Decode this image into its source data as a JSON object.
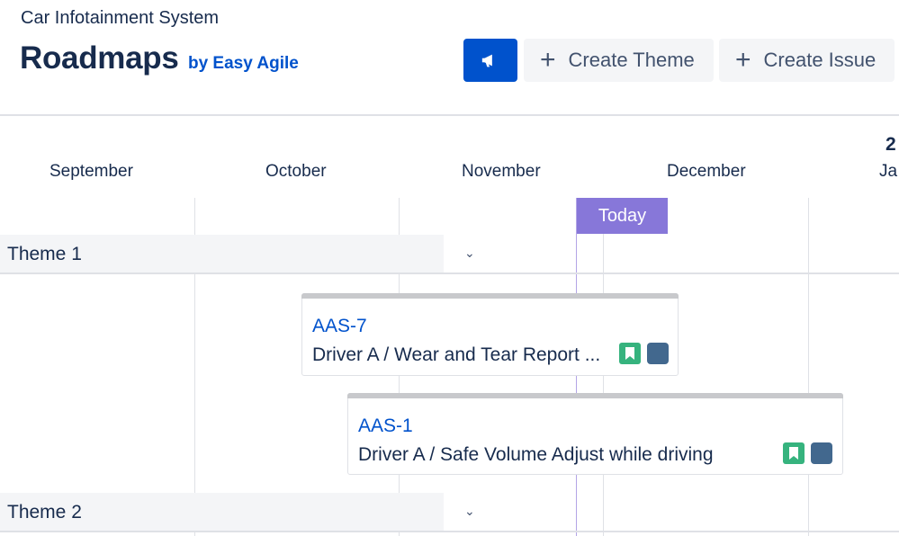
{
  "project": {
    "name": "Car Infotainment System"
  },
  "header": {
    "title": "Roadmaps",
    "byline": "by Easy Agile",
    "create_theme_label": "Create Theme",
    "create_issue_label": "Create Issue"
  },
  "timeline": {
    "year_label": "2",
    "months": [
      "September",
      "October",
      "November",
      "December",
      "Ja"
    ],
    "today_label": "Today"
  },
  "themes": [
    {
      "name": "Theme 1"
    },
    {
      "name": "Theme 2"
    }
  ],
  "issues": [
    {
      "key": "AAS-7",
      "summary": "Driver A / Wear and Tear Report ..."
    },
    {
      "key": "AAS-1",
      "summary": "Driver A / Safe Volume Adjust while driving"
    }
  ],
  "colors": {
    "primary": "#0052cc",
    "today": "#8777d9",
    "story": "#36b37e",
    "status": "#42688e"
  }
}
